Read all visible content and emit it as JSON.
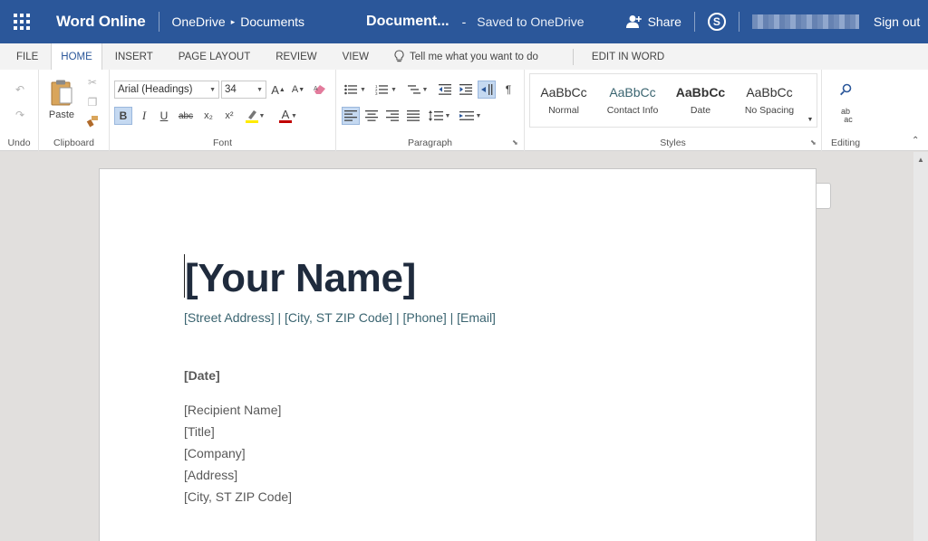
{
  "titlebar": {
    "app_name": "Word Online",
    "breadcrumb_root": "OneDrive",
    "breadcrumb_folder": "Documents",
    "document_name": "Document...",
    "separator": "-",
    "save_status": "Saved to OneDrive",
    "share_label": "Share",
    "sign_out_label": "Sign out"
  },
  "tabs": {
    "file": "FILE",
    "home": "HOME",
    "insert": "INSERT",
    "page_layout": "PAGE LAYOUT",
    "review": "REVIEW",
    "view": "VIEW",
    "tell_me": "Tell me what you want to do",
    "edit_in_word": "EDIT IN WORD"
  },
  "ribbon": {
    "groups": {
      "undo": "Undo",
      "clipboard": "Clipboard",
      "font": "Font",
      "paragraph": "Paragraph",
      "styles": "Styles",
      "editing": "Editing"
    },
    "paste_label": "Paste",
    "font_name": "Arial (Headings)",
    "font_size": "34",
    "bold": "B",
    "italic": "I",
    "underline": "U",
    "strikethrough": "abc",
    "subscript": "x₂",
    "superscript": "x²",
    "font_color": "A",
    "grow_font": "A",
    "shrink_font": "A",
    "replace_top": "ab",
    "replace_bottom": "ac",
    "styles": [
      {
        "sample": "AaBbCc",
        "name": "Normal"
      },
      {
        "sample": "AaBbCc",
        "name": "Contact Info"
      },
      {
        "sample": "AaBbCc",
        "name": "Date"
      },
      {
        "sample": "AaBbCc",
        "name": "No Spacing"
      }
    ]
  },
  "document": {
    "name": "[Your Name]",
    "contact_line": "[Street Address] | [City, ST ZIP Code] | [Phone] | [Email]",
    "date": "[Date]",
    "recipient_name": "[Recipient Name]",
    "title": "[Title]",
    "company": "[Company]",
    "address": "[Address]",
    "city_zip": "[City, ST ZIP Code]"
  },
  "colors": {
    "title_bar": "#2b579a",
    "name_text": "#1f2b3d",
    "contact_text": "#3a6470",
    "body_text": "#595959"
  }
}
